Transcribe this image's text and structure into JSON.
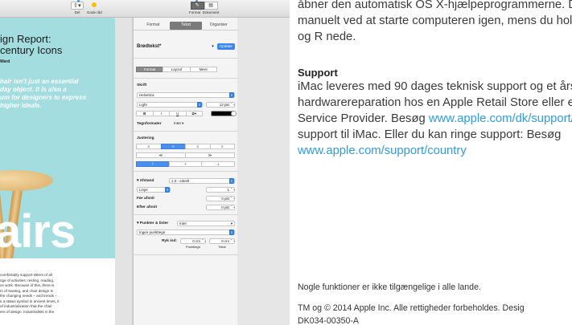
{
  "toolbar": {
    "share_label": "Del",
    "tips_label": "Gode råd",
    "format_label": "Format",
    "document_label": "Dokument"
  },
  "document": {
    "title_line1": "ign Report:",
    "title_line2": "century Icons",
    "author": "Ward",
    "quote_lines": [
      "hair isn't just an essential",
      "day object. It is also a",
      "um for designers to express",
      "higher ideals."
    ],
    "big_word": "airs",
    "body_lines": [
      "comfortably support sitters of all",
      "nge of activities: resting, reading,",
      "ce work. Because of this, there is",
      "m of seating, and chair design is",
      "the changing needs – and trends –",
      "s a status symbol in ancient times, it",
      "of industrialization that the chair",
      "ere of design. Industrialists in the"
    ]
  },
  "inspector": {
    "tabs": [
      "Format",
      "Tekst",
      "Organiser"
    ],
    "active_tab": "Tekst",
    "paragraph_style": "Brødtekst*",
    "update_button": "Opdater",
    "subtabs": [
      "Format",
      "Layout",
      "Mere"
    ],
    "font_section": "Skrift",
    "font_name": "Helvetica",
    "font_weight": "Light",
    "font_size": "12 pkt",
    "bold": "B",
    "italic": "I",
    "underline": "U",
    "char_format_label": "Tegnformater",
    "char_format_value": "Intet",
    "alignment_section": "Justering",
    "spacing_label": "Afstand",
    "spacing_value": "1,0 - enkelt",
    "lines_label": "Linjer",
    "lines_value": "1",
    "before_label": "Før afsnit",
    "before_value": "0 pkt",
    "after_label": "Efter afsnit",
    "after_value": "0 pkt",
    "bullets_label": "Punkter & lister",
    "bullets_value": "Intet",
    "bullets_style": "Ingen punkttegn",
    "indent_label": "Ryk ind:",
    "indent_value1": "0 cm",
    "indent_value2": "0 cm",
    "indent_sub1": "Punkttegn",
    "indent_sub2": "Tekst"
  },
  "manual": {
    "line1": "åbner den automatisk OS X-hjælpeprogrammerne. Du kan",
    "line2": "manuelt ved at starte computeren igen, mens du holder",
    "line3": "og R nede.",
    "support_heading": "Support",
    "s1": "iMac leveres med 90 dages teknisk support og et års",
    "s2": "hardwarereparation hos en Apple Retail Store eller en",
    "s3a": "Service Provider. Besøg ",
    "s3link": "www.apple.com/dk/support/imac",
    "s4": "support til iMac. Eller du kan ringe support: Besøg",
    "s5link": "www.apple.com/support/country",
    "note1": "Nogle funktioner er ikke tilgængelige i alle lande.",
    "note2": "TM og © 2014 Apple Inc. Alle rettigheder forbeholdes. Desig",
    "note3": "DK034-00350-A"
  },
  "colors": {
    "hero_bg": "#a3dde0",
    "accent_blue": "#2f7fe0",
    "link_blue": "#2f9be0"
  }
}
